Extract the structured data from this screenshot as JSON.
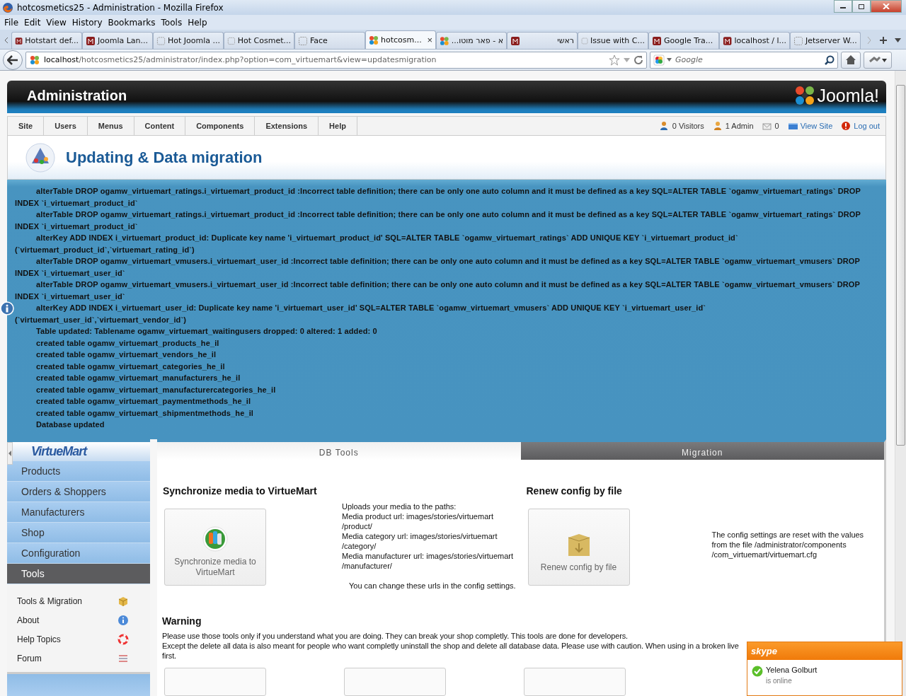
{
  "window": {
    "title": "hotcosmetics25 - Administration - Mozilla Firefox"
  },
  "menu_bar": [
    "File",
    "Edit",
    "View",
    "History",
    "Bookmarks",
    "Tools",
    "Help"
  ],
  "browser_tabs": [
    {
      "label": "Hotstart def...",
      "kind": "brand",
      "selected": false
    },
    {
      "label": "Joomla Lan...",
      "kind": "brand",
      "selected": false
    },
    {
      "label": "Hot Joomla ...",
      "kind": "page",
      "selected": false
    },
    {
      "label": "Hot Cosmet...",
      "kind": "page",
      "selected": false
    },
    {
      "label": "Face",
      "kind": "page",
      "selected": false
    },
    {
      "label": "hotcosm...",
      "kind": "joomla",
      "selected": true,
      "close": "×"
    },
    {
      "label": "א - פאר מוטו...",
      "kind": "joomla",
      "selected": false
    },
    {
      "label": "ראשי",
      "kind": "brand",
      "selected": false
    },
    {
      "label": "Issue with C...",
      "kind": "page",
      "selected": false
    },
    {
      "label": "Google Tra...",
      "kind": "brand",
      "selected": false
    },
    {
      "label": "localhost / l...",
      "kind": "brand",
      "selected": false
    },
    {
      "label": "Jetserver W...",
      "kind": "page",
      "selected": false
    }
  ],
  "address_bar": {
    "host": "localhost",
    "path": "/hotcosmetics25/administrator/index.php?option=com_virtuemart&view=updatesmigration"
  },
  "search_field": {
    "placeholder": "Google"
  },
  "admin_header": {
    "title": "Administration",
    "logo": "Joomla!"
  },
  "admin_menu": [
    "Site",
    "Users",
    "Menus",
    "Content",
    "Components",
    "Extensions",
    "Help"
  ],
  "status": [
    {
      "kind": "visitors",
      "label": "0 Visitors"
    },
    {
      "kind": "admin",
      "label": "1 Admin"
    },
    {
      "kind": "messages",
      "label": "0"
    },
    {
      "kind": "link",
      "label": "View Site"
    },
    {
      "kind": "logout",
      "label": "Log out"
    }
  ],
  "page_title": "Updating & Data migration",
  "messages": [
    "alterTable DROP ogamw_virtuemart_ratings.i_virtuemart_product_id :Incorrect table definition; there can be only one auto column and it must be defined as a key SQL=ALTER TABLE `ogamw_virtuemart_ratings` DROP INDEX `i_virtuemart_product_id`",
    "alterTable DROP ogamw_virtuemart_ratings.i_virtuemart_product_id :Incorrect table definition; there can be only one auto column and it must be defined as a key SQL=ALTER TABLE `ogamw_virtuemart_ratings` DROP INDEX `i_virtuemart_product_id`",
    "alterKey ADD INDEX i_virtuemart_product_id: Duplicate key name 'i_virtuemart_product_id' SQL=ALTER TABLE `ogamw_virtuemart_ratings` ADD UNIQUE KEY `i_virtuemart_product_id` (`virtuemart_product_id`,`virtuemart_rating_id`)",
    "alterTable DROP ogamw_virtuemart_vmusers.i_virtuemart_user_id :Incorrect table definition; there can be only one auto column and it must be defined as a key SQL=ALTER TABLE `ogamw_virtuemart_vmusers` DROP INDEX `i_virtuemart_user_id`",
    "alterTable DROP ogamw_virtuemart_vmusers.i_virtuemart_user_id :Incorrect table definition; there can be only one auto column and it must be defined as a key SQL=ALTER TABLE `ogamw_virtuemart_vmusers` DROP INDEX `i_virtuemart_user_id`",
    "alterKey ADD INDEX i_virtuemart_user_id: Duplicate key name 'i_virtuemart_user_id' SQL=ALTER TABLE `ogamw_virtuemart_vmusers` ADD UNIQUE KEY `i_virtuemart_user_id` (`virtuemart_user_id`,`virtuemart_vendor_id`)",
    "Table updated: Tablename ogamw_virtuemart_waitingusers dropped: 0 altered: 1 added: 0",
    "created table ogamw_virtuemart_products_he_il",
    "created table ogamw_virtuemart_vendors_he_il",
    "created table ogamw_virtuemart_categories_he_il",
    "created table ogamw_virtuemart_manufacturers_he_il",
    "created table ogamw_virtuemart_manufacturercategories_he_il",
    "created table ogamw_virtuemart_paymentmethods_he_il",
    "created table ogamw_virtuemart_shipmentmethods_he_il",
    "Database updated"
  ],
  "sidebar": {
    "logo": "VirtueMart",
    "items": [
      {
        "label": "Products",
        "selected": false
      },
      {
        "label": "Orders & Shoppers",
        "selected": false
      },
      {
        "label": "Manufacturers",
        "selected": false
      },
      {
        "label": "Shop",
        "selected": false
      },
      {
        "label": "Configuration",
        "selected": false
      },
      {
        "label": "Tools",
        "selected": true
      }
    ],
    "sub_items": [
      {
        "label": "Tools & Migration",
        "kind": "box"
      },
      {
        "label": "About",
        "kind": "info"
      },
      {
        "label": "Help Topics",
        "kind": "lifebuoy"
      },
      {
        "label": "Forum",
        "kind": "forum"
      }
    ]
  },
  "content_tabs": [
    {
      "label": "DB Tools",
      "selected": true
    },
    {
      "label": "Migration",
      "selected": false
    }
  ],
  "sections": [
    {
      "title": "Synchronize media to VirtueMart",
      "button": "Synchronize media to VirtueMart",
      "kind": "media",
      "description": [
        "Uploads your media to the paths:",
        "Media product url: images/stories/virtuemart /product/",
        "Media category url: images/stories/virtuemart /category/",
        "Media manufacturer url: images/stories/virtuemart /manufacturer/"
      ],
      "note": "You can change these urls in the config settings."
    },
    {
      "title": "Renew config by file",
      "button": "Renew config by file",
      "kind": "config",
      "description": [
        "The config settings are reset with the values from the file /administrator/components /com_virtuemart/virtuemart.cfg"
      ]
    }
  ],
  "warning": {
    "title": "Warning",
    "lines": [
      "Please use those tools only if you understand what you are doing. They can break your shop completly. This tools are done for developers.",
      "Except the delete all data is also meant for people who want completly uninstall the shop and delete all database data. Please use with caution. When using in a broken live",
      "first."
    ]
  },
  "skype_popup": {
    "brand": "skype",
    "name": "Yelena Golburt",
    "status": "is online"
  }
}
